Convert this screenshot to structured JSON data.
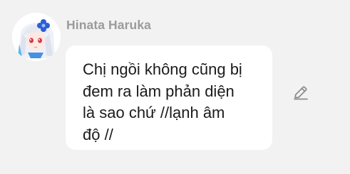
{
  "chat": {
    "sender_name": "Hinata Haruka",
    "message_text": "Chị ngồi không cũng bị\nđem ra làm phản diện\nlà sao chứ //lạnh âm\nđộ //"
  },
  "icons": {
    "avatar": "anime-girl-avatar",
    "edit": "pencil-edit-icon"
  },
  "colors": {
    "background": "#f2f2f2",
    "bubble": "#ffffff",
    "sender_name": "#9b9b9b",
    "message_text": "#1b1b1b",
    "edit_icon": "#8d8d8d"
  }
}
